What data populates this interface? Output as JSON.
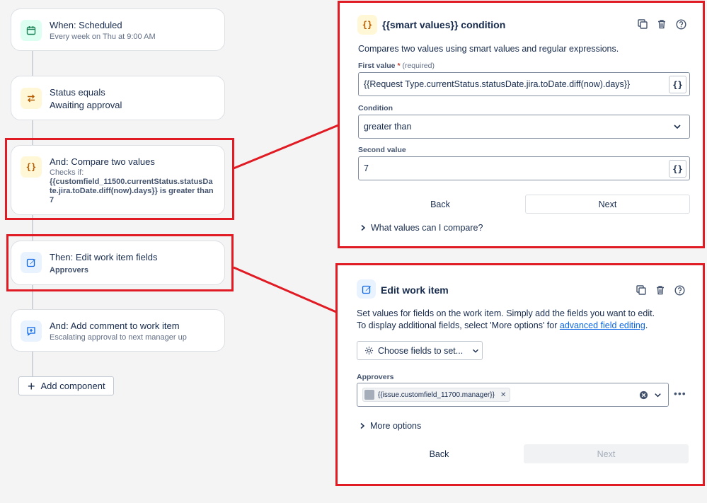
{
  "flow": {
    "nodes": [
      {
        "title": "When: Scheduled",
        "subtitle": "Every week on Thu at 9:00 AM",
        "icon": "calendar-icon"
      },
      {
        "title": "Status equals",
        "subtitle": "Awaiting approval",
        "icon": "swap-arrows-icon"
      },
      {
        "title": "And: Compare two values",
        "subtitle": "Checks if:",
        "detail": "{{customfield_11500.currentStatus.statusDate.jira.toDate.diff(now).days}} is greater than 7",
        "icon": "braces-icon"
      },
      {
        "title": "Then: Edit work item fields",
        "subtitle": "Approvers",
        "icon": "pencil-icon"
      },
      {
        "title": "And: Add comment to work item",
        "subtitle": "Escalating approval to next manager up",
        "icon": "comment-plus-icon"
      }
    ],
    "add_component": "Add component"
  },
  "condition_panel": {
    "title": "{{smart values}} condition",
    "description": "Compares two values using smart values and regular expressions.",
    "first_value_label": "First value",
    "first_value_required": "(required)",
    "first_value": "{{Request Type.currentStatus.statusDate.jira.toDate.diff(now).days}}",
    "condition_label": "Condition",
    "condition_value": "greater than",
    "second_value_label": "Second value",
    "second_value": "7",
    "brace_symbol": "{}",
    "back": "Back",
    "next": "Next",
    "expander": "What values can I compare?"
  },
  "edit_panel": {
    "title": "Edit work item",
    "description_line1": "Set values for fields on the work item. Simply add the fields you want to edit.",
    "description_line2_prefix": "To display additional fields, select 'More options' for ",
    "description_link": "advanced field editing",
    "description_suffix": ".",
    "choose_fields": "Choose fields to set...",
    "approvers_label": "Approvers",
    "approver_chip": "{{issue.customfield_11700.manager}}",
    "more_options": "More options",
    "back": "Back",
    "next": "Next"
  },
  "colors": {
    "highlight": "#e01b24",
    "link": "#0c66e4"
  }
}
